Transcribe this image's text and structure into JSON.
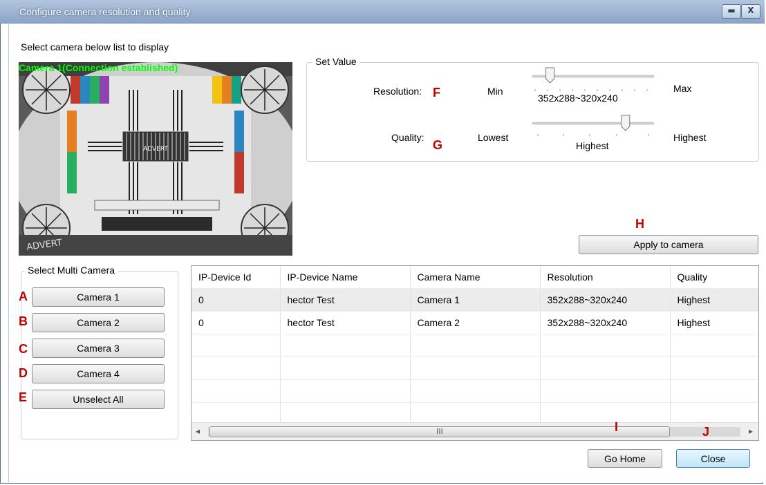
{
  "window": {
    "title": "Configure camera resolution and quality",
    "minimize_glyph": "▬",
    "close_glyph": "X"
  },
  "preview": {
    "instruction": "Select camera below list to display",
    "overlay_text": "Camera 1(Connection established)",
    "chart_brand": "ADVERT",
    "chart_brand_bottom": "ADVERT"
  },
  "set_value": {
    "group_label": "Set Value",
    "resolution_label": "Resolution:",
    "resolution_min": "Min",
    "resolution_max": "Max",
    "resolution_value": "352x288~320x240",
    "resolution_level": 0.1,
    "quality_label": "Quality:",
    "quality_min": "Lowest",
    "quality_max": "Highest",
    "quality_value": "Highest",
    "quality_level": 0.8
  },
  "apply_button": "Apply to camera",
  "multi_camera": {
    "group_label": "Select Multi Camera",
    "buttons": [
      "Camera 1",
      "Camera 2",
      "Camera 3",
      "Camera 4",
      "Unselect All"
    ]
  },
  "annotations": {
    "a": "A",
    "b": "B",
    "c": "C",
    "d": "D",
    "e": "E",
    "f": "F",
    "g": "G",
    "h": "H",
    "i": "I",
    "j": "J"
  },
  "table": {
    "columns": [
      "IP-Device Id",
      "IP-Device Name",
      "Camera Name",
      "Resolution",
      "Quality"
    ],
    "rows": [
      [
        "0",
        "hector Test",
        "Camera 1",
        "352x288~320x240",
        "Highest"
      ],
      [
        "0",
        "hector Test",
        "Camera 2",
        "352x288~320x240",
        "Highest"
      ]
    ],
    "scroll_left_glyph": "◂",
    "scroll_right_glyph": "▸",
    "thumb_grip": "III"
  },
  "footer": {
    "go_home": "Go Home",
    "close": "Close"
  },
  "colors": {
    "overlay_text": "#00ff00",
    "annotation": "#c00000",
    "title_bar": "#8aa4c8"
  }
}
